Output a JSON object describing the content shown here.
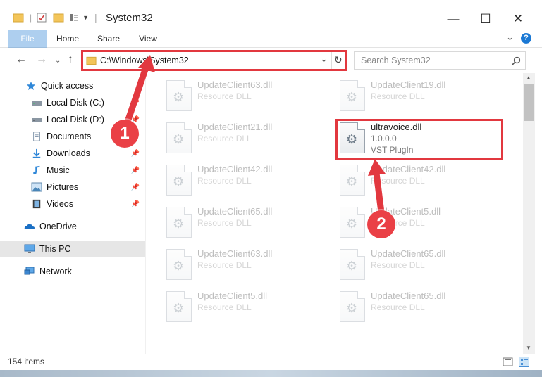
{
  "window": {
    "title": "System32",
    "minimize": "—",
    "maximize": "☐",
    "close": "✕"
  },
  "ribbon": {
    "tabs": [
      "File",
      "Home",
      "Share",
      "View"
    ],
    "collapse": "⌄",
    "help": "?"
  },
  "address": {
    "path": "C:\\Windows\\System32",
    "dropdown": "⌄",
    "refresh": "↻"
  },
  "search": {
    "placeholder": "Search System32",
    "icon": "search-icon"
  },
  "sidebar": {
    "items": [
      {
        "label": "Quick access",
        "icon": "star-icon",
        "pinned": false
      },
      {
        "label": "Local Disk (C:)",
        "icon": "drive-icon",
        "pinned": true
      },
      {
        "label": "Local Disk (D:)",
        "icon": "drive-icon",
        "pinned": true
      },
      {
        "label": "Documents",
        "icon": "documents-icon",
        "pinned": true
      },
      {
        "label": "Downloads",
        "icon": "downloads-icon",
        "pinned": true
      },
      {
        "label": "Music",
        "icon": "music-icon",
        "pinned": true
      },
      {
        "label": "Pictures",
        "icon": "pictures-icon",
        "pinned": true
      },
      {
        "label": "Videos",
        "icon": "videos-icon",
        "pinned": true
      },
      {
        "label": "OneDrive",
        "icon": "cloud-icon",
        "pinned": false
      },
      {
        "label": "This PC",
        "icon": "computer-icon",
        "pinned": false
      },
      {
        "label": "Network",
        "icon": "network-icon",
        "pinned": false
      }
    ]
  },
  "files": [
    {
      "name": "UpdateClient63.dll",
      "line2": "Resource DLL",
      "line3": "",
      "active": false
    },
    {
      "name": "UpdateClient19.dll",
      "line2": "Resource DLL",
      "line3": "",
      "active": false
    },
    {
      "name": "UpdateClient21.dll",
      "line2": "Resource DLL",
      "line3": "",
      "active": false
    },
    {
      "name": "ultravoice.dll",
      "line2": "1.0.0.0",
      "line3": "VST PlugIn",
      "active": true
    },
    {
      "name": "UpdateClient42.dll",
      "line2": "Resource DLL",
      "line3": "",
      "active": false
    },
    {
      "name": "UpdateClient42.dll",
      "line2": "Resource DLL",
      "line3": "",
      "active": false
    },
    {
      "name": "UpdateClient65.dll",
      "line2": "Resource DLL",
      "line3": "",
      "active": false
    },
    {
      "name": "UpdateClient5.dll",
      "line2": "Resource DLL",
      "line3": "",
      "active": false
    },
    {
      "name": "UpdateClient63.dll",
      "line2": "Resource DLL",
      "line3": "",
      "active": false
    },
    {
      "name": "UpdateClient65.dll",
      "line2": "Resource DLL",
      "line3": "",
      "active": false
    },
    {
      "name": "UpdateClient5.dll",
      "line2": "Resource DLL",
      "line3": "",
      "active": false
    },
    {
      "name": "UpdateClient65.dll",
      "line2": "Resource DLL",
      "line3": "",
      "active": false
    }
  ],
  "status": {
    "count": "154 items"
  },
  "annotations": {
    "marker1": "1",
    "marker2": "2",
    "color": "#e2383f"
  },
  "colors": {
    "accent": "#1a78d4",
    "selected_bg": "#e6e6e6"
  }
}
